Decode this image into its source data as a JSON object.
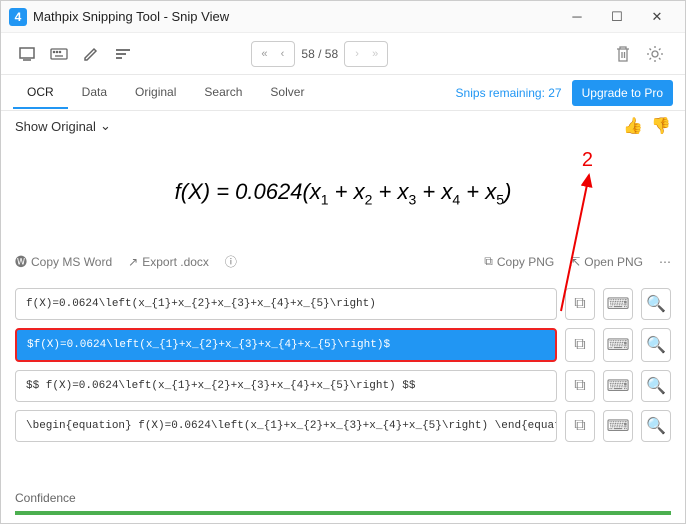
{
  "window": {
    "title": "Mathpix Snipping Tool - Snip View",
    "logo": "4"
  },
  "pager": {
    "page": "58 / 58"
  },
  "tabs": {
    "ocr": "OCR",
    "data": "Data",
    "original": "Original",
    "search": "Search",
    "solver": "Solver"
  },
  "upgrade": {
    "remaining": "Snips remaining: 27",
    "button": "Upgrade to Pro"
  },
  "original": {
    "label": "Show Original"
  },
  "annotation": {
    "num": "2"
  },
  "export": {
    "word": "Copy MS Word",
    "docx": "Export .docx",
    "copypng": "Copy PNG",
    "openpng": "Open PNG"
  },
  "code": {
    "r1": "f(X)=0.0624\\left(x_{1}+x_{2}+x_{3}+x_{4}+x_{5}\\right)",
    "r2": "$f(X)=0.0624\\left(x_{1}+x_{2}+x_{3}+x_{4}+x_{5}\\right)$",
    "r3": "$$  f(X)=0.0624\\left(x_{1}+x_{2}+x_{3}+x_{4}+x_{5}\\right)  $$",
    "r4": "\\begin{equation}  f(X)=0.0624\\left(x_{1}+x_{2}+x_{3}+x_{4}+x_{5}\\right)  \\end{equatio"
  },
  "confidence": {
    "label": "Confidence"
  }
}
